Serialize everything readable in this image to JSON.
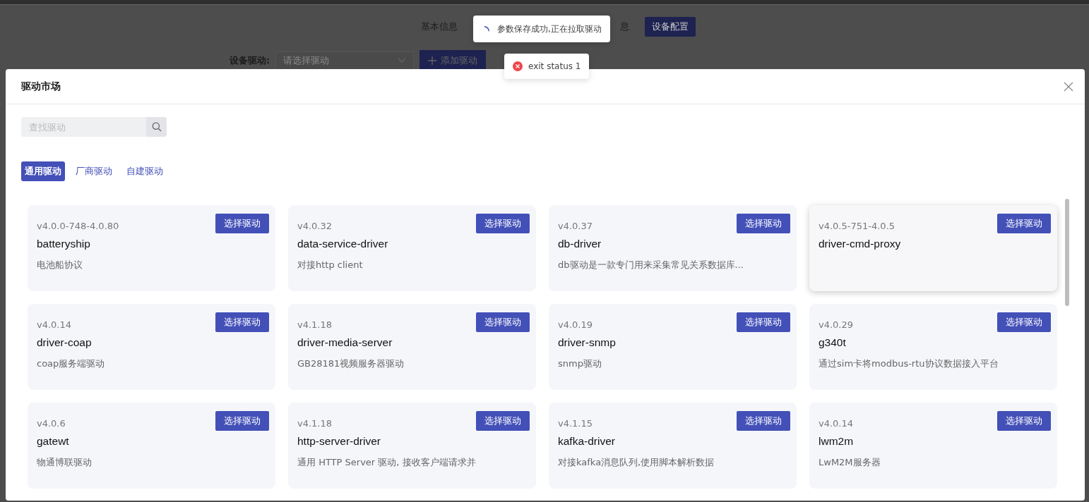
{
  "background": {
    "tabs": [
      {
        "label": "基本信息",
        "selected": false
      },
      {
        "label": "息",
        "selected": false
      },
      {
        "label": "设备配置",
        "selected": true
      }
    ],
    "driver_field": {
      "label": "设备驱动:",
      "placeholder": "请选择驱动"
    },
    "add_button": "添加驱动"
  },
  "toasts": [
    {
      "kind": "loading",
      "text": "参数保存成功,正在拉取驱动"
    },
    {
      "kind": "error",
      "text": "exit status 1"
    }
  ],
  "modal": {
    "title": "驱动市场",
    "search": {
      "placeholder": "查找驱动"
    },
    "tabs": [
      {
        "label": "通用驱动",
        "selected": true
      },
      {
        "label": "厂商驱动",
        "selected": false
      },
      {
        "label": "自建驱动",
        "selected": false
      }
    ],
    "cards": [
      {
        "version": "v4.0.0-748-4.0.80",
        "name": "batteryship",
        "description": "电池船协议",
        "button": "选择驱动",
        "hovered": false
      },
      {
        "version": "v4.0.32",
        "name": "data-service-driver",
        "description": "对接http client",
        "button": "选择驱动",
        "hovered": false
      },
      {
        "version": "v4.0.37",
        "name": "db-driver",
        "description": "db驱动是一款专门用来采集常见关系数据库...",
        "button": "选择驱动",
        "hovered": false
      },
      {
        "version": "v4.0.5-751-4.0.5",
        "name": "driver-cmd-proxy",
        "button": "选择驱动",
        "hovered": true
      },
      {
        "version": "v4.0.14",
        "name": "driver-coap",
        "description": "coap服务端驱动",
        "button": "选择驱动",
        "hovered": false
      },
      {
        "version": "v4.1.18",
        "name": "driver-media-server",
        "description": "GB28181视频服务器驱动",
        "button": "选择驱动",
        "hovered": false
      },
      {
        "version": "v4.0.19",
        "name": "driver-snmp",
        "description": "snmp驱动",
        "button": "选择驱动",
        "hovered": false
      },
      {
        "version": "v4.0.29",
        "name": "g340t",
        "description": "通过sim卡将modbus-rtu协议数据接入平台",
        "button": "选择驱动",
        "hovered": false
      },
      {
        "version": "v4.0.6",
        "name": "gatewt",
        "description": "物通博联驱动",
        "button": "选择驱动",
        "hovered": false
      },
      {
        "version": "v4.1.18",
        "name": "http-server-driver",
        "description": "通用 HTTP Server 驱动, 接收客户端请求并",
        "button": "选择驱动",
        "hovered": false
      },
      {
        "version": "v4.1.15",
        "name": "kafka-driver",
        "description": "对接kafka消息队列,使用脚本解析数据",
        "button": "选择驱动",
        "hovered": false
      },
      {
        "version": "v4.0.14",
        "name": "lwm2m",
        "description": "LwM2M服务器",
        "button": "选择驱动",
        "hovered": false
      }
    ]
  }
}
